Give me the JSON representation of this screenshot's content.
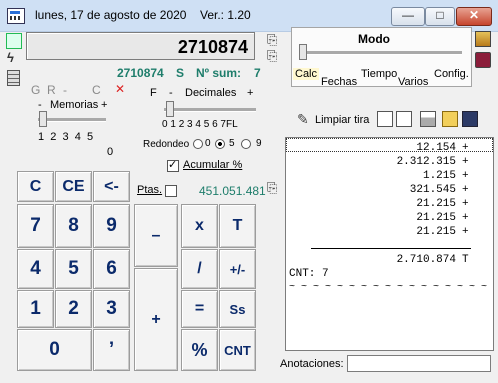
{
  "window": {
    "title": "lunes,  17 de agosto de 2020",
    "version": "Ver.: 1.20",
    "min_label": "—",
    "max_label": "□",
    "close_label": "✕"
  },
  "display": {
    "value": "2710874",
    "sub_value": "2710874",
    "sub_flag": "S",
    "sum_label": "Nº sum:",
    "sum_count": "7"
  },
  "memory": {
    "flags": [
      "G",
      "R",
      "-",
      "C"
    ],
    "close_x": "✕",
    "title": "Memorias",
    "minus": "-",
    "plus": "+",
    "scale": [
      "1",
      "2",
      "3",
      "4",
      "5"
    ],
    "current": "0"
  },
  "decimals": {
    "f": "F",
    "minus": "-",
    "title": "Decimales",
    "plus": "+",
    "scale": [
      "0",
      "1",
      "2",
      "3",
      "4",
      "5",
      "6",
      "7",
      "FL"
    ]
  },
  "rounding": {
    "label": "Redondeo",
    "options": [
      "0",
      "5",
      "9"
    ],
    "selected": "5"
  },
  "acumular": {
    "label": "Acumular %",
    "checked": true
  },
  "ptas": {
    "label": "Ptas.",
    "checked": false,
    "value": "451.051.481"
  },
  "modo": {
    "title": "Modo",
    "options": [
      "Calc",
      "Fechas",
      "Tiempo",
      "Varios",
      "Config."
    ],
    "selected": "Calc"
  },
  "tape_toolbar": {
    "clear_label": "Limpiar tira"
  },
  "tape": {
    "lines": [
      {
        "value": "12.154",
        "op": "+"
      },
      {
        "value": "2.312.315",
        "op": "+"
      },
      {
        "value": "1.215",
        "op": "+"
      },
      {
        "value": "321.545",
        "op": "+"
      },
      {
        "value": "21.215",
        "op": "+"
      },
      {
        "value": "21.215",
        "op": "+"
      },
      {
        "value": "21.215",
        "op": "+"
      }
    ],
    "total": {
      "value": "2.710.874",
      "op": "T"
    },
    "count_line": "CNT: 7",
    "wave_line": "~ ~ ~ ~ ~ ~ ~ ~ ~ ~ ~ ~ ~ ~ ~ ~ ~"
  },
  "annotations": {
    "label": "Anotaciones:",
    "value": ""
  },
  "keys": {
    "c": "C",
    "ce": "CE",
    "back": "<-",
    "n7": "7",
    "n8": "8",
    "n9": "9",
    "n4": "4",
    "n5": "5",
    "n6": "6",
    "n1": "1",
    "n2": "2",
    "n3": "3",
    "n0": "0",
    "dot": "’",
    "minus": "–",
    "plus": "+",
    "mul": "x",
    "div": "/",
    "eq": "=",
    "t": "T",
    "pm": "+/-",
    "ss": "Ss",
    "pct": "%",
    "cnt": "CNT"
  },
  "colors": {
    "key_text": "#0b2a6b",
    "teal": "#1e7d6b",
    "titlebar": "#cfe0f4"
  }
}
